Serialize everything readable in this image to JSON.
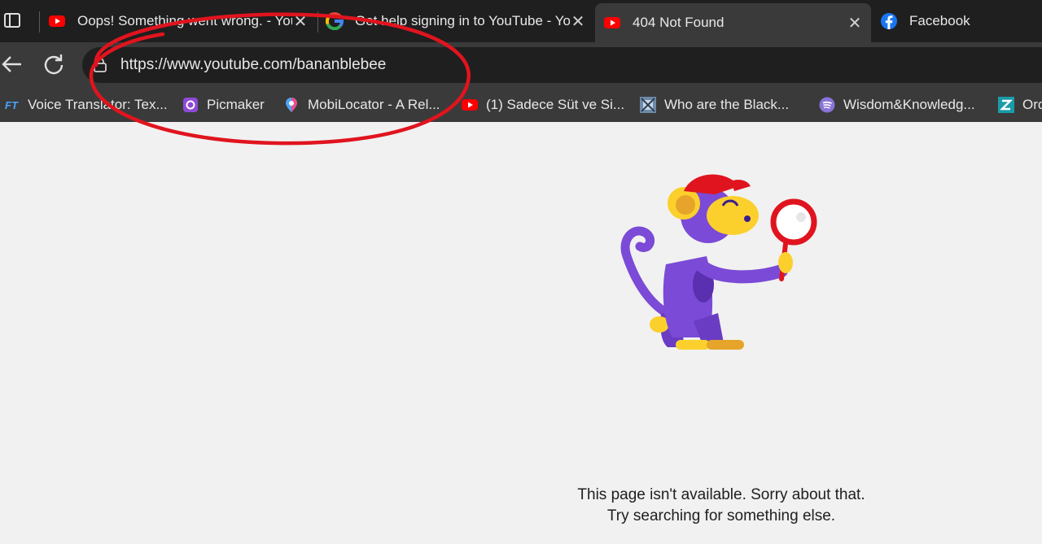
{
  "tabs": [
    {
      "title": "Oops! Something went wrong. - YouTube",
      "favicon": "youtube-icon",
      "active": false
    },
    {
      "title": "Get help signing in to YouTube - YouTube Help",
      "favicon": "google-icon",
      "active": false
    },
    {
      "title": "404 Not Found",
      "favicon": "youtube-icon",
      "active": true
    },
    {
      "title": "Facebook",
      "favicon": "facebook-icon",
      "active": false
    }
  ],
  "address_bar": {
    "url": "https://www.youtube.com/bananblebee"
  },
  "bookmarks": [
    {
      "label": "Voice Translator: Tex...",
      "icon": "ft-icon"
    },
    {
      "label": "Picmaker",
      "icon": "picmaker-icon"
    },
    {
      "label": "MobiLocator - A Rel...",
      "icon": "location-pin-icon"
    },
    {
      "label": "(1) Sadece Süt ve Si...",
      "icon": "youtube-icon"
    },
    {
      "label": "Who are the Black...",
      "icon": "image-icon"
    },
    {
      "label": "Wisdom&Knowledg...",
      "icon": "spotify-icon"
    },
    {
      "label": "Orc",
      "icon": "z-icon"
    }
  ],
  "error": {
    "line1": "This page isn't available. Sorry about that.",
    "line2": "Try searching for something else."
  },
  "colors": {
    "youtube_red": "#ff0000",
    "annotation_red": "#e0141e",
    "facebook_blue": "#1877f2",
    "monkey_purple": "#7b4ad6",
    "monkey_yellow": "#fcd02c"
  }
}
